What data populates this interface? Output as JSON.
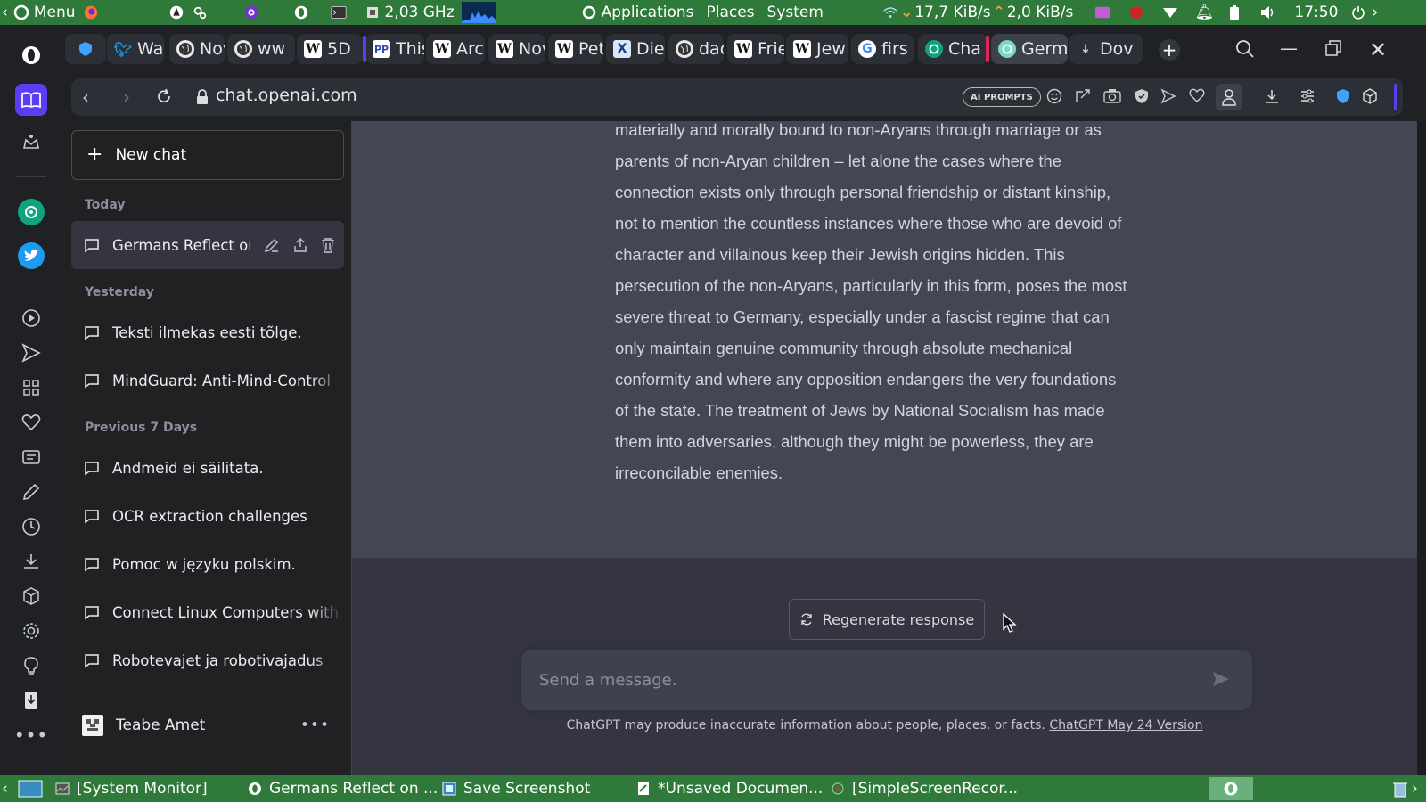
{
  "os_panel": {
    "menu_label": "Menu",
    "cpu_freq": "2,03 GHz",
    "applications": "Applications",
    "places": "Places",
    "system": "System",
    "net_down": "17,7 KiB/s",
    "net_up": "2,0 KiB/s",
    "clock": "17:50"
  },
  "browser": {
    "tabs": [
      {
        "label": "Waf",
        "icon": "twitter-icon"
      },
      {
        "label": "Nov",
        "icon": "globe-icon"
      },
      {
        "label": "ww",
        "icon": "globe-icon"
      },
      {
        "label": "5D",
        "icon": "wikipedia-icon"
      },
      {
        "label": "This",
        "icon": "pp-icon"
      },
      {
        "label": "Arc",
        "icon": "wikipedia-icon"
      },
      {
        "label": "Nov",
        "icon": "wikipedia-icon"
      },
      {
        "label": "Pet",
        "icon": "wikipedia-icon"
      },
      {
        "label": "Die",
        "icon": "x-icon"
      },
      {
        "label": "dac",
        "icon": "globe-icon"
      },
      {
        "label": "Frie",
        "icon": "wikipedia-icon"
      },
      {
        "label": "Jew",
        "icon": "wikipedia-icon"
      },
      {
        "label": "firs",
        "icon": "google-icon"
      },
      {
        "label": "Cha",
        "icon": "chatgpt-icon"
      },
      {
        "label": "Germar",
        "icon": "chatgpt-icon"
      },
      {
        "label": "Dov",
        "icon": "download-icon"
      }
    ],
    "url": "chat.openai.com",
    "ai_prompts": "AI PROMPTS"
  },
  "chatgpt": {
    "new_chat": "New chat",
    "groups": {
      "today": "Today",
      "yesterday": "Yesterday",
      "previous7": "Previous 7 Days"
    },
    "conversations": {
      "today": [
        "Germans Reflect on"
      ],
      "yesterday": [
        "Teksti ilmekas eesti tõlge.",
        "MindGuard: Anti-Mind-Control"
      ],
      "previous7": [
        "Andmeid ei säilitata.",
        "OCR extraction challenges",
        "Pomoc w języku polskim.",
        "Connect Linux Computers with",
        "Robotevajet ja robotivajadus"
      ]
    },
    "user_name": "Teabe Amet",
    "answer": "materially and morally bound to non-Aryans through marriage or as parents of non-Aryan children – let alone the cases where the connection exists only through personal friendship or distant kinship, not to mention the countless instances where those who are devoid of character and villainous keep their Jewish origins hidden. This persecution of the non-Aryans, particularly in this form, poses the most severe threat to Germany, especially under a fascist regime that can only maintain genuine community through absolute mechanical conformity and where any opposition endangers the very foundations of the state. The treatment of Jews by National Socialism has made them into adversaries, although they might be powerless, they are irreconcilable enemies.",
    "regenerate": "Regenerate response",
    "input_placeholder": "Send a message.",
    "footer_text": "ChatGPT may produce inaccurate information about people, places, or facts.",
    "footer_link": "ChatGPT May 24 Version"
  },
  "taskbar": {
    "items": [
      "[System Monitor]",
      "Germans Reflect on ...",
      "Save Screenshot",
      "*Unsaved Documen...",
      "[SimpleScreenRecor..."
    ]
  }
}
